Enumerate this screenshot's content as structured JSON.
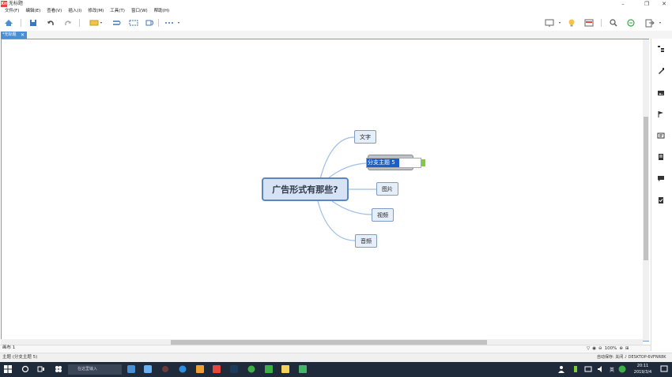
{
  "window": {
    "logo_text": "Xm",
    "title": "无标题",
    "controls": {
      "minimize": "–",
      "maximize": "❐",
      "close": "✕"
    }
  },
  "menu": [
    "文件(F)",
    "编辑(E)",
    "查看(V)",
    "插入(I)",
    "修改(M)",
    "工具(T)",
    "窗口(W)",
    "帮助(H)"
  ],
  "toolbar": {
    "left_icons": [
      "home-icon",
      "save-icon",
      "undo-icon",
      "redo-icon",
      "topic-style-icon",
      "relationship-icon",
      "boundary-icon",
      "summary-icon",
      "more-icon"
    ],
    "right_icons": [
      "presentation-icon",
      "idea-bulb-icon",
      "slideshow-icon",
      "search-icon",
      "share-icon",
      "export-icon"
    ]
  },
  "tab": {
    "label": "*无标题",
    "close": "✕"
  },
  "mindmap": {
    "root": "广告形式有那些?",
    "branches": [
      "文字",
      "分支主题 5",
      "图片",
      "视频",
      "音频"
    ],
    "editing_text": "分支主题 5"
  },
  "right_panel_icons": [
    "outline-icon",
    "format-brush-icon",
    "image-icon",
    "flag-icon",
    "text-icon",
    "notes-icon",
    "comment-icon",
    "task-icon"
  ],
  "sheetbar": {
    "sheet": "画布 1",
    "zoom": "100%"
  },
  "statusbar": {
    "left": "主题 (分支主题 5)",
    "right": "自动保存: 关闭   ♪ DESKTOP-6VFNR8K"
  },
  "taskbar": {
    "search_placeholder": "在这里输入",
    "time": "20:11",
    "date": "2019/3/4",
    "lang": "英"
  }
}
